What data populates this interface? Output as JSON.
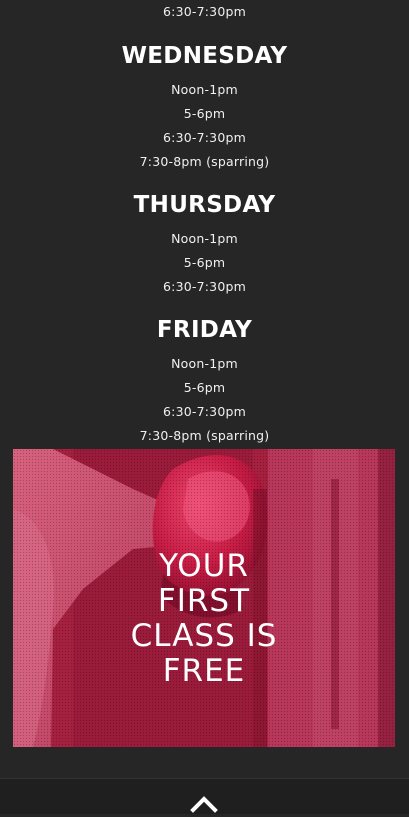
{
  "schedule": {
    "top_time": "6:30-7:30pm",
    "wednesday": {
      "title": "WEDNESDAY",
      "times": [
        "Noon-1pm",
        "5-6pm",
        "6:30-7:30pm",
        "7:30-8pm (sparring)"
      ]
    },
    "thursday": {
      "title": "THURSDAY",
      "times": [
        "Noon-1pm",
        "5-6pm",
        "6:30-7:30pm"
      ]
    },
    "friday": {
      "title": "FRIDAY",
      "times": [
        "Noon-1pm",
        "5-6pm",
        "6:30-7:30pm",
        "7:30-8pm (sparring)"
      ]
    }
  },
  "promo": {
    "lines": [
      "YOUR",
      "FIRST",
      "CLASS IS",
      "FREE"
    ],
    "overlay_color": "#b0173e"
  },
  "footer": {
    "back_to_top_icon": "chevron-up-icon"
  }
}
